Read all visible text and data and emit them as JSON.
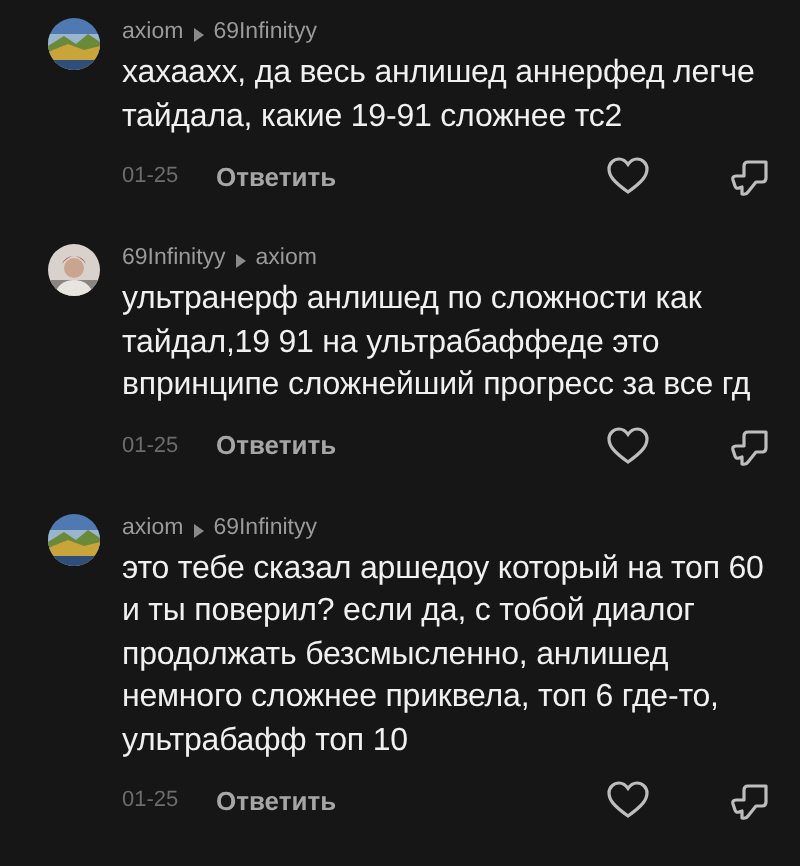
{
  "comments": [
    {
      "author": "axiom",
      "reply_to": "69Infinityy",
      "text": "хахаахх, да весь анлишед аннерфед легче тайдала, какие 19-91 сложнее тс2",
      "date": "01-25",
      "reply_label": "Ответить",
      "liked": false,
      "disliked": false
    },
    {
      "author": "69Infinityy",
      "reply_to": "axiom",
      "text": "ультранерф анлишед по сложности как тайдал,19 91 на ультрабаффеде это впринципе сложнейший прогресс за все гд",
      "date": "01-25",
      "reply_label": "Ответить",
      "liked": false,
      "disliked": false
    },
    {
      "author": "axiom",
      "reply_to": "69Infinityy",
      "text": "это тебе сказал аршедоу который на топ 60 и ты поверил? если да, с тобой диалог продолжать безсмысленно, анлишед немного сложнее приквела, топ 6 где-то, ультрабафф топ 10",
      "date": "01-25",
      "reply_label": "Ответить",
      "liked": false,
      "disliked": false
    }
  ]
}
